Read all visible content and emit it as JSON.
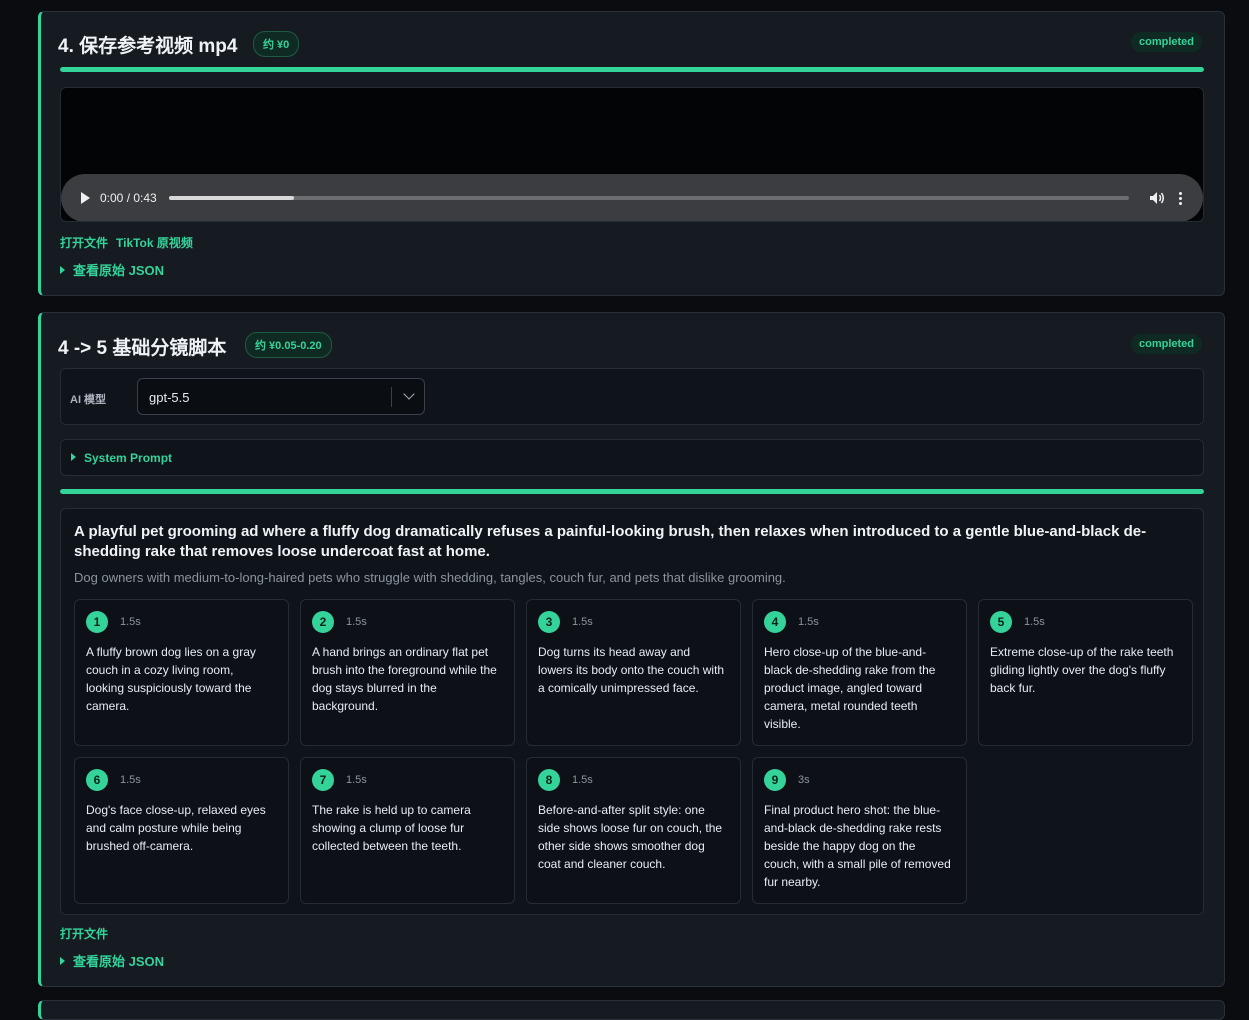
{
  "card1": {
    "title": "4. 保存参考视频 mp4",
    "price": "约 ¥0",
    "status": "completed",
    "progress": 1.0,
    "player": {
      "time": "0:00 / 0:43",
      "seek_progress": 0.13
    },
    "links": {
      "open_file": "打开文件",
      "tiktok": "TikTok 原视频"
    },
    "raw_json": "查看原始 JSON"
  },
  "card2": {
    "title": "4 -> 5 基础分镜脚本",
    "price": "约 ¥0.05-0.20",
    "status": "completed",
    "model_label": "AI 模型",
    "model_value": "gpt-5.5",
    "system_prompt": "System Prompt",
    "progress": 1.0,
    "concept": "A playful pet grooming ad where a fluffy dog dramatically refuses a painful-looking brush, then relaxes when introduced to a gentle blue-and-black de-shedding rake that removes loose undercoat fast at home.",
    "audience": "Dog owners with medium-to-long-haired pets who struggle with shedding, tangles, couch fur, and pets that dislike grooming.",
    "shots": [
      {
        "num": "1",
        "duration": "1.5s",
        "desc": "A fluffy brown dog lies on a gray couch in a cozy living room, looking suspiciously toward the camera."
      },
      {
        "num": "2",
        "duration": "1.5s",
        "desc": "A hand brings an ordinary flat pet brush into the foreground while the dog stays blurred in the background."
      },
      {
        "num": "3",
        "duration": "1.5s",
        "desc": "Dog turns its head away and lowers its body onto the couch with a comically unimpressed face."
      },
      {
        "num": "4",
        "duration": "1.5s",
        "desc": "Hero close-up of the blue-and-black de-shedding rake from the product image, angled toward camera, metal rounded teeth visible."
      },
      {
        "num": "5",
        "duration": "1.5s",
        "desc": "Extreme close-up of the rake teeth gliding lightly over the dog's fluffy back fur."
      },
      {
        "num": "6",
        "duration": "1.5s",
        "desc": "Dog's face close-up, relaxed eyes and calm posture while being brushed off-camera."
      },
      {
        "num": "7",
        "duration": "1.5s",
        "desc": "The rake is held up to camera showing a clump of loose fur collected between the teeth."
      },
      {
        "num": "8",
        "duration": "1.5s",
        "desc": "Before-and-after split style: one side shows loose fur on couch, the other side shows smoother dog coat and cleaner couch."
      },
      {
        "num": "9",
        "duration": "3s",
        "desc": "Final product hero shot: the blue-and-black de-shedding rake rests beside the happy dog on the couch, with a small pile of removed fur nearby."
      }
    ],
    "open_file": "打开文件",
    "raw_json": "查看原始 JSON"
  },
  "colors": {
    "accent": "#34d399",
    "background": "#0a0c10",
    "card": "#161b22"
  }
}
